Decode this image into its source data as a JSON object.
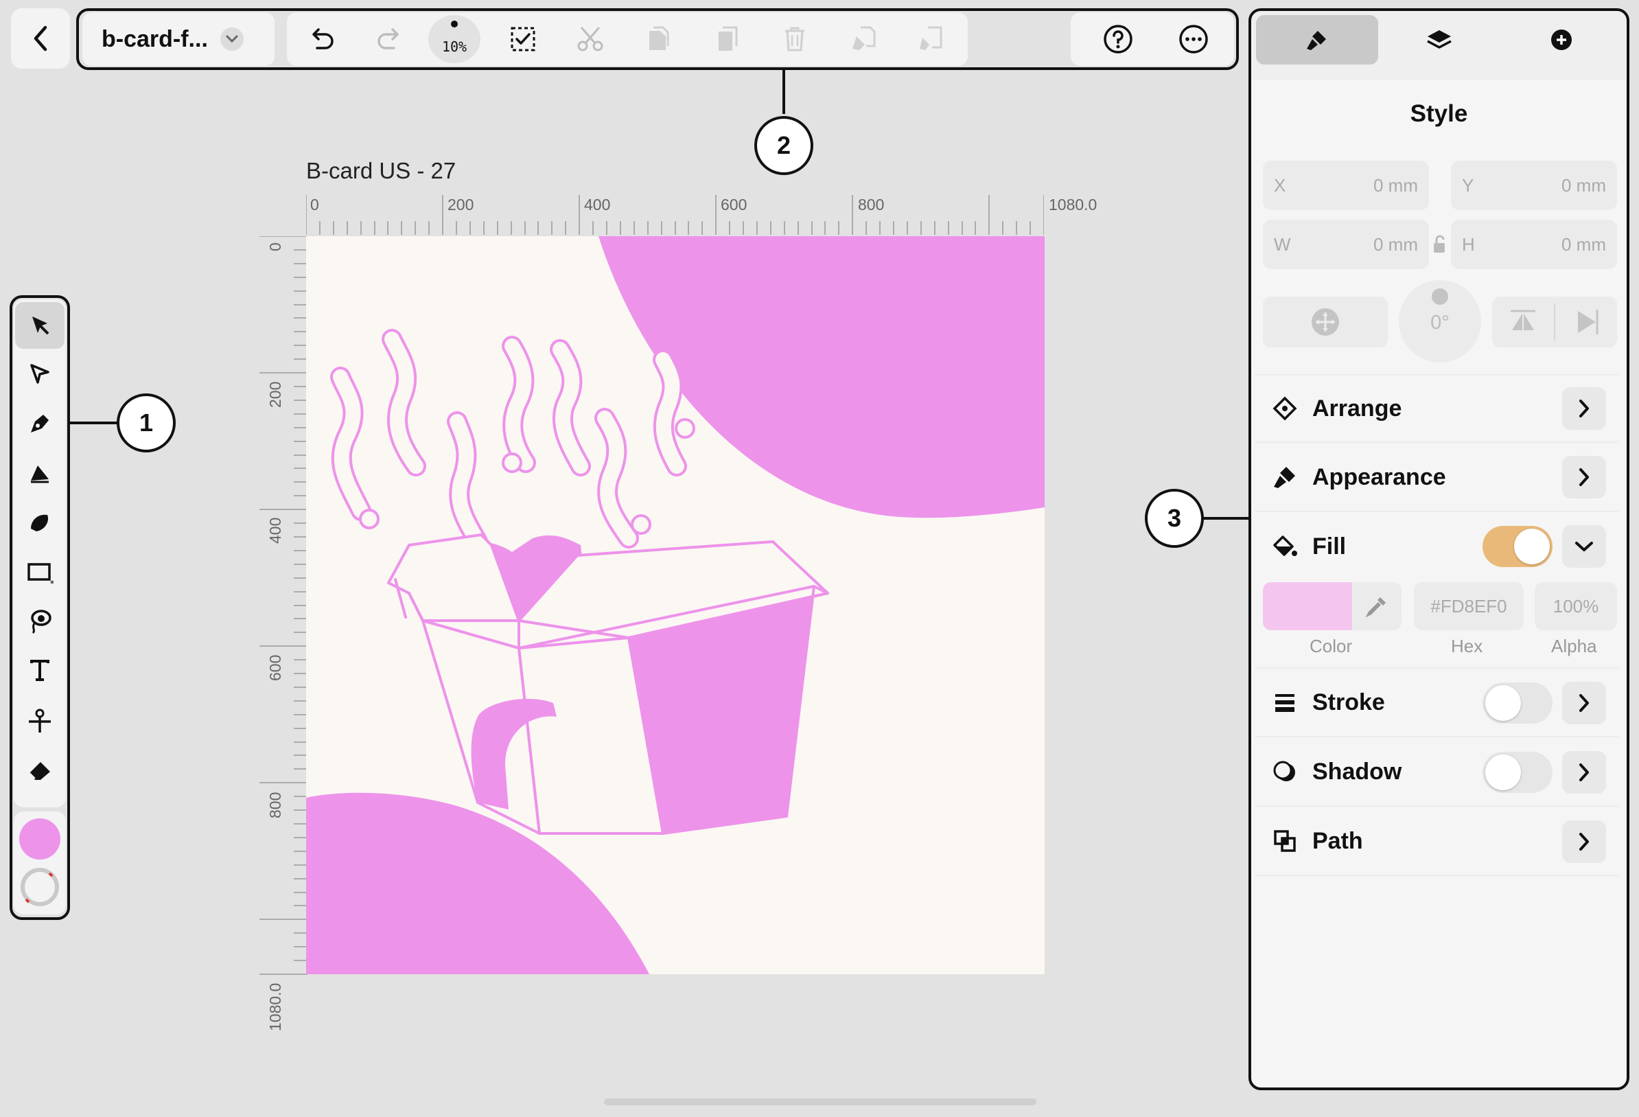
{
  "document": {
    "filename": "b-card-f...",
    "zoom": "10%"
  },
  "artboard": {
    "title": "B-card US - 27"
  },
  "ruler": {
    "h_labels": [
      "0",
      "200",
      "400",
      "600",
      "800",
      "1080.0"
    ],
    "v_labels": [
      "0",
      "200",
      "400",
      "600",
      "800",
      "1080.0"
    ]
  },
  "callouts": {
    "one": "1",
    "two": "2",
    "three": "3"
  },
  "panel": {
    "tabs": [
      "brush-icon",
      "layers-icon",
      "add-icon"
    ],
    "title": "Style",
    "x_label": "X",
    "x_value": "0 mm",
    "y_label": "Y",
    "y_value": "0 mm",
    "w_label": "W",
    "w_value": "0 mm",
    "h_label": "H",
    "h_value": "0 mm",
    "rotation": "0°",
    "arrange": "Arrange",
    "appearance": "Appearance",
    "fill": "Fill",
    "fill_enabled": true,
    "fill_hex": "#FD8EF0",
    "fill_alpha": "100%",
    "fill_color": "#f4c6ef",
    "color_label": "Color",
    "hex_label": "Hex",
    "alpha_label": "Alpha",
    "stroke": "Stroke",
    "stroke_enabled": false,
    "shadow": "Shadow",
    "shadow_enabled": false,
    "path": "Path"
  },
  "colors": {
    "accent_pink": "#ed93ea",
    "canvas": "#fbf7f3",
    "toggle_on": "#e9b97a"
  },
  "toolbar_icons": [
    "undo-icon",
    "redo-icon",
    "zoom-indicator",
    "select-all-icon",
    "cut-icon",
    "copy-icon",
    "paste-icon",
    "delete-icon",
    "copy-style-icon",
    "paste-style-icon",
    "help-icon",
    "more-icon"
  ],
  "tools": [
    "select-tool",
    "direct-select-tool",
    "pen-tool",
    "vector-brush-tool",
    "pencil-tool",
    "shape-tool",
    "lasso-fill-tool",
    "text-tool",
    "scissors-tool",
    "eraser-tool"
  ]
}
